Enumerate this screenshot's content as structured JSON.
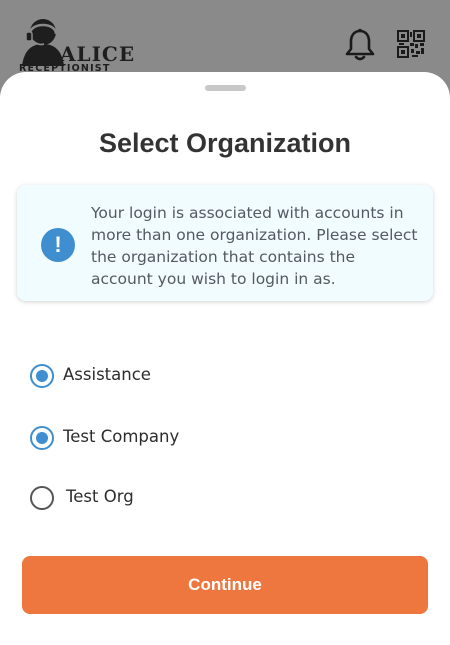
{
  "header": {
    "logo_title": "ALICE",
    "logo_subtitle": "RECEPTIONIST",
    "notification_icon": "bell-icon",
    "qr_icon": "qr-code-icon"
  },
  "sheet": {
    "title": "Select Organization",
    "info": {
      "icon": "exclamation-circle-icon",
      "icon_glyph": "!",
      "message": "Your login is associated with accounts in more than one organization. Please select the organization that contains the account you wish to login in as."
    },
    "options": [
      {
        "label": "Assistance",
        "checked": true
      },
      {
        "label": "Test Company",
        "checked": true
      },
      {
        "label": "Test Org",
        "checked": false
      }
    ],
    "continue_label": "Continue"
  },
  "colors": {
    "accent_blue": "#3e8ed0",
    "button_orange": "#ee763f",
    "info_bg": "#f0fcff",
    "backdrop": "#8a8a8a"
  }
}
